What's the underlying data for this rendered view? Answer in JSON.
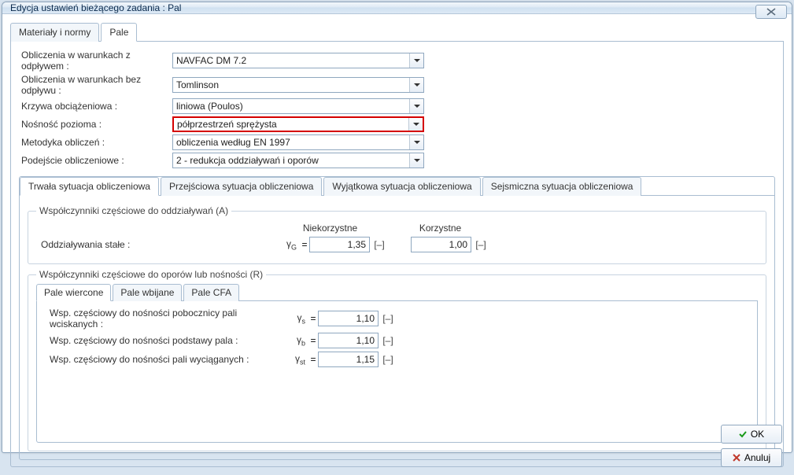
{
  "window": {
    "title": "Edycja ustawień bieżącego zadania : Pal"
  },
  "mainTabs": {
    "tab0": "Materiały i normy",
    "tab1": "Pale"
  },
  "form": {
    "row0": {
      "label": "Obliczenia w warunkach z odpływem :",
      "value": "NAVFAC DM 7.2"
    },
    "row1": {
      "label": "Obliczenia w warunkach bez odpływu :",
      "value": "Tomlinson"
    },
    "row2": {
      "label": "Krzywa obciążeniowa :",
      "value": "liniowa (Poulos)"
    },
    "row3": {
      "label": "Nośność pozioma :",
      "value": "półprzestrzeń sprężysta"
    },
    "row4": {
      "label": "Metodyka obliczeń :",
      "value": "obliczenia według EN 1997"
    },
    "row5": {
      "label": "Podejście obliczeniowe :",
      "value": "2 - redukcja oddziaływań i oporów"
    }
  },
  "situations": {
    "tab0": "Trwała sytuacja obliczeniowa",
    "tab1": "Przejściowa sytuacja obliczeniowa",
    "tab2": "Wyjątkowa sytuacja obliczeniowa",
    "tab3": "Sejsmiczna sytuacja obliczeniowa"
  },
  "groupA": {
    "legend": "Współczynniki częściowe do oddziaływań (A)",
    "hdr_unfav": "Niekorzystne",
    "hdr_fav": "Korzystne",
    "row0": {
      "label": "Oddziaływania stałe :",
      "sym": "γG",
      "eq": "=",
      "v1": "1,35",
      "u1": "[–]",
      "v2": "1,00",
      "u2": "[–]"
    }
  },
  "groupR": {
    "legend": "Współczynniki częściowe do oporów lub nośności (R)",
    "pileTabs": {
      "t0": "Pale wiercone",
      "t1": "Pale wbijane",
      "t2": "Pale CFA"
    },
    "rows": {
      "r0": {
        "label": "Wsp. częściowy do nośności pobocznicy pali wciskanych :",
        "sym": "γs",
        "eq": "=",
        "v": "1,10",
        "u": "[–]"
      },
      "r1": {
        "label": "Wsp. częściowy do nośności podstawy pala :",
        "sym": "γb",
        "eq": "=",
        "v": "1,10",
        "u": "[–]"
      },
      "r2": {
        "label": "Wsp. częściowy do nośności pali wyciąganych :",
        "sym": "γst",
        "eq": "=",
        "v": "1,15",
        "u": "[–]"
      }
    }
  },
  "buttons": {
    "ok": "OK",
    "cancel": "Anuluj"
  }
}
